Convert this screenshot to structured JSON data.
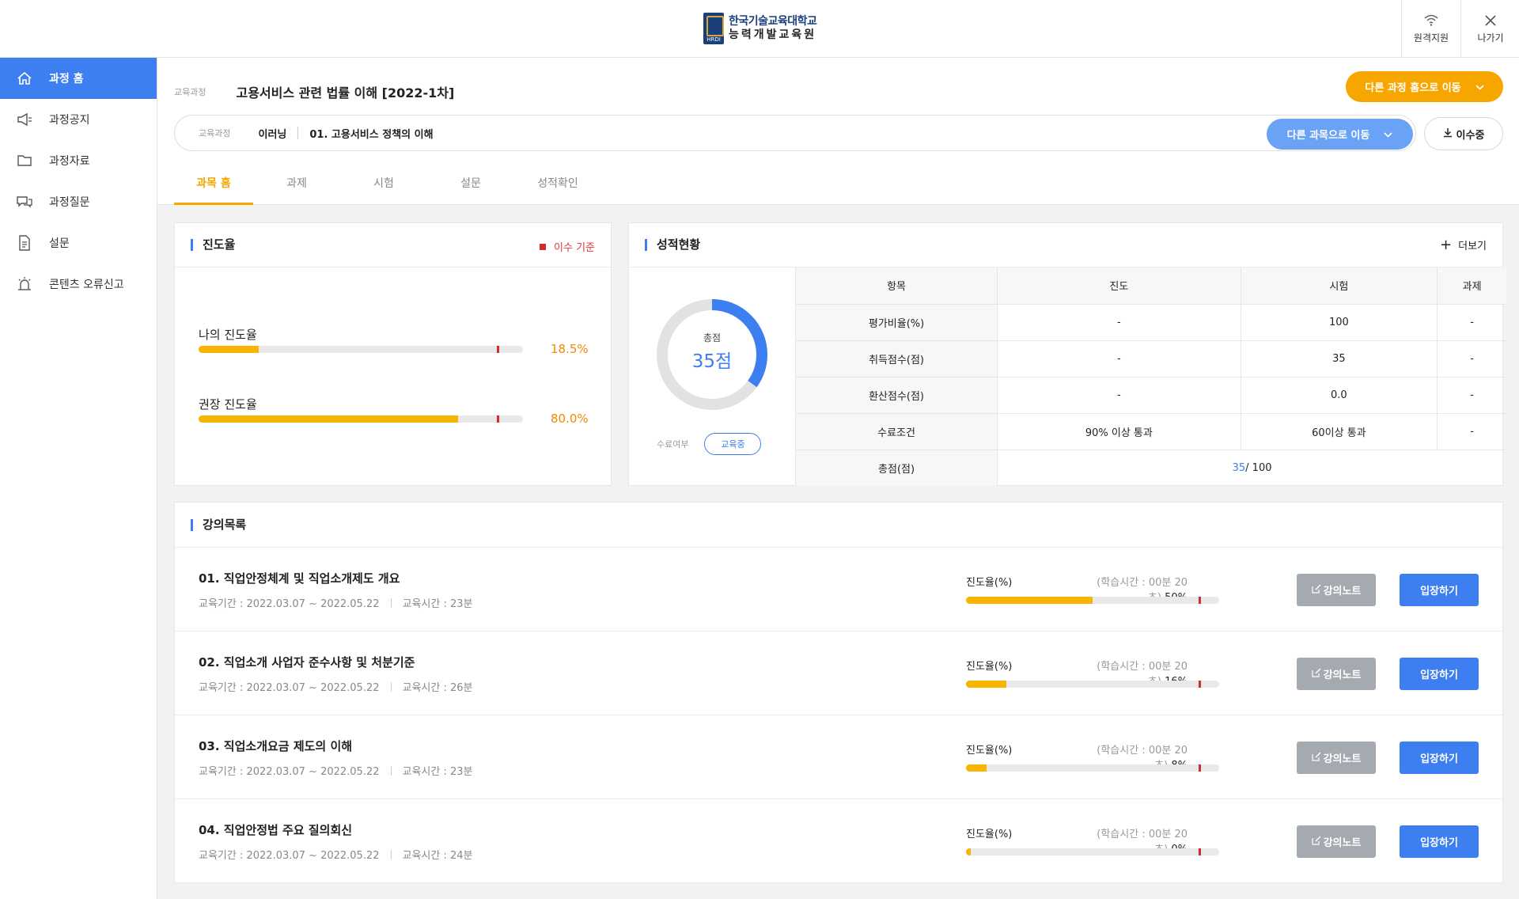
{
  "header": {
    "logo_line1": "한국기술교육대학교",
    "logo_line2": "능력개발교육원",
    "remote_label": "원격지원",
    "exit_label": "나가기"
  },
  "sidebar": {
    "items": [
      {
        "label": "과정 홈",
        "icon": "home-icon",
        "active": true
      },
      {
        "label": "과정공지",
        "icon": "megaphone-icon"
      },
      {
        "label": "과정자료",
        "icon": "folder-icon"
      },
      {
        "label": "과정질문",
        "icon": "chat-icon"
      },
      {
        "label": "설문",
        "icon": "document-icon"
      },
      {
        "label": "콘텐츠 오류신고",
        "icon": "alarm-icon"
      }
    ]
  },
  "course": {
    "label": "교육과정",
    "title": "고용서비스 관련 법률 이해 [2022-1차]",
    "other_course_button": "다른 과정 홈으로 이동",
    "subject_label": "교육과정",
    "subject_type": "이러닝",
    "subject_name": "01. 고용서비스 정책의 이해",
    "other_subject_button": "다른 과목으로 이동",
    "status_button": "이수중"
  },
  "tabs": [
    "과목 홈",
    "과제",
    "시험",
    "설문",
    "성적확인"
  ],
  "progress_card": {
    "title": "진도율",
    "legend": "이수 기준",
    "mine_label": "나의 진도율",
    "mine_value": "18.5%",
    "mine_pct": 18.5,
    "recommended_label": "권장 진도율",
    "recommended_value": "80.0%",
    "recommended_pct": 80.0,
    "criterion_pct": 92
  },
  "grade_card": {
    "title": "성적현황",
    "more": "더보기",
    "total_label": "총점",
    "total_value": "35점",
    "total_score": 35,
    "max_score": 100,
    "done_label": "수료여부",
    "done_badge": "교육중",
    "columns": [
      "항목",
      "진도",
      "시험",
      "과제"
    ],
    "rows": [
      {
        "item": "평가비율(%)",
        "progress": "-",
        "exam": "100",
        "task": "-"
      },
      {
        "item": "취득점수(점)",
        "progress": "-",
        "exam": "35",
        "task": "-"
      },
      {
        "item": "환산점수(점)",
        "progress": "-",
        "exam": "0.0",
        "task": "-"
      },
      {
        "item": "수료조건",
        "progress": "90% 이상 통과",
        "exam": "60이상 통과",
        "task": "-"
      }
    ],
    "total_row": {
      "item": "총점(점)",
      "score": "35",
      "max": "/ 100"
    }
  },
  "lectures": {
    "title": "강의목록",
    "progress_label": "진도율(%)",
    "note_button": "강의노트",
    "enter_button": "입장하기",
    "items": [
      {
        "title": "01. 직업안정체계 및 직업소개제도 개요",
        "period": "교육기간 : 2022.03.07 ~ 2022.05.22",
        "duration": "교육시간 : 23분",
        "time": "(학습시간 : 00분 20초)",
        "pct_text": "50%",
        "pct": 50
      },
      {
        "title": "02. 직업소개 사업자 준수사항 및 처분기준",
        "period": "교육기간 : 2022.03.07 ~ 2022.05.22",
        "duration": "교육시간 : 26분",
        "time": "(학습시간 : 00분 20초)",
        "pct_text": "16%",
        "pct": 16
      },
      {
        "title": "03. 직업소개요금 제도의 이해",
        "period": "교육기간 : 2022.03.07 ~ 2022.05.22",
        "duration": "교육시간 : 23분",
        "time": "(학습시간 : 00분 20초)",
        "pct_text": "8%",
        "pct": 8
      },
      {
        "title": "04. 직업안정법 주요 질의회신",
        "period": "교육기간 : 2022.03.07 ~ 2022.05.22",
        "duration": "교육시간 : 24분",
        "time": "(학습시간 : 00분 20초)",
        "pct_text": "0%",
        "pct": 0
      }
    ]
  },
  "colors": {
    "accent": "#3d7ef0",
    "orange": "#f7a600",
    "progress": "#f7b500",
    "criterion": "#d42c2c"
  }
}
